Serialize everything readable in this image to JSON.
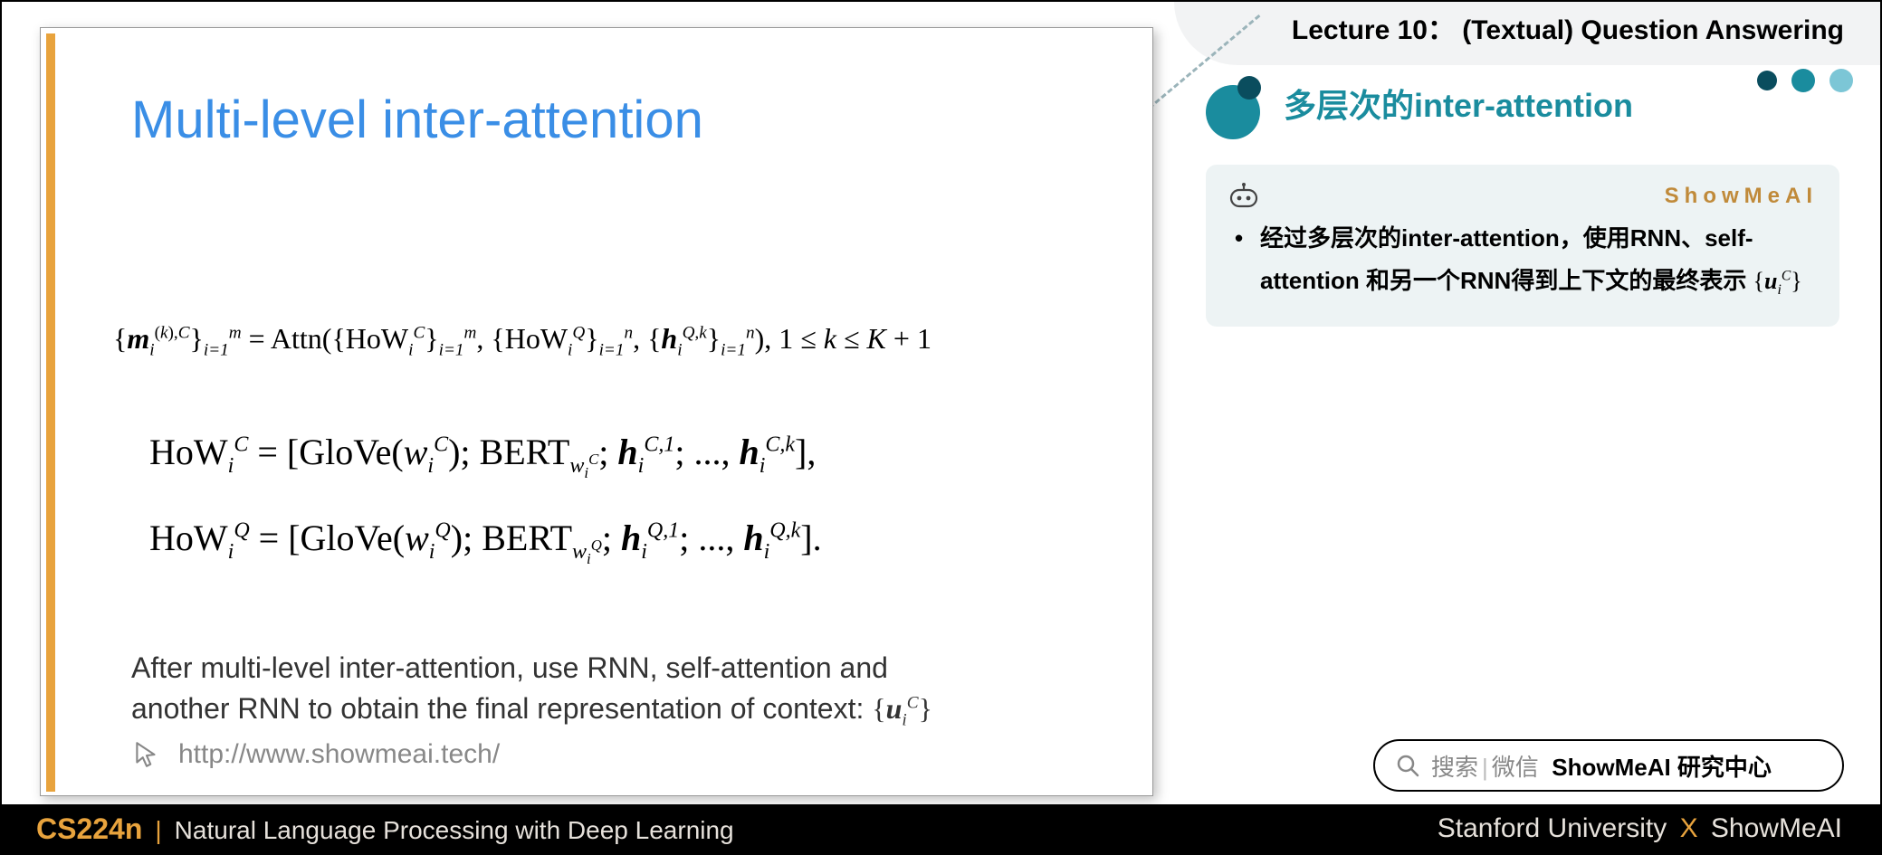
{
  "lecture_label": "Lecture 10： (Textual) Question Answering",
  "slide": {
    "title": "Multi-level inter-attention",
    "desc_line1": "After multi-level inter-attention, use RNN, self-attention and",
    "desc_line2_prefix": "another RNN to obtain the final representation of context: ",
    "url": "http://www.showmeai.tech/"
  },
  "section_title": "多层次的inter-attention",
  "note": {
    "brand": "ShowMeAI",
    "bullet_prefix": "经过多层次的inter-attention，使用RNN、self-attention 和另一个RNN得到上下文的最终表示 "
  },
  "search": {
    "label1": "搜索",
    "label2": "微信",
    "strong": "ShowMeAI 研究中心"
  },
  "footer": {
    "code": "CS224n",
    "name": "Natural Language Processing with Deep Learning",
    "right_a": "Stanford University",
    "right_b": "ShowMeAI"
  }
}
